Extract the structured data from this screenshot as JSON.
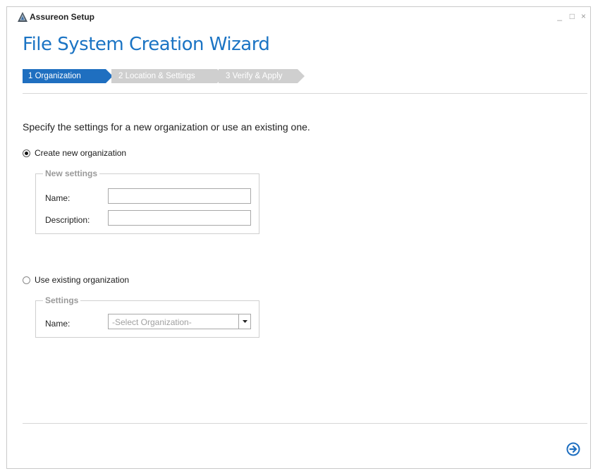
{
  "window": {
    "title": "Assureon Setup"
  },
  "titlebar": {
    "minimize": "_",
    "maximize": "□",
    "close": "×"
  },
  "wizard": {
    "title": "File System Creation Wizard"
  },
  "steps": [
    {
      "label": "1 Organization",
      "state": "active"
    },
    {
      "label": "2 Location & Settings",
      "state": "inactive"
    },
    {
      "label": "3 Verify & Apply",
      "state": "inactive"
    }
  ],
  "colors": {
    "accent": "#1f6fc0",
    "title": "#1b74c4",
    "inactive_step": "#cfcfcf"
  },
  "instructions": "Specify the settings for a new organization or use an existing one.",
  "create_new": {
    "label": "Create new organization",
    "selected": true,
    "group_title": "New settings",
    "name_label": "Name:",
    "name_value": "",
    "description_label": "Description:",
    "description_value": ""
  },
  "use_existing": {
    "label": "Use existing organization",
    "selected": false,
    "group_title": "Settings",
    "name_label": "Name:",
    "select_placeholder": "-Select Organization-"
  },
  "icons": {
    "app": "assureon-logo-icon",
    "next": "arrow-right-circle-icon",
    "dropdown": "chevron-down-icon"
  }
}
